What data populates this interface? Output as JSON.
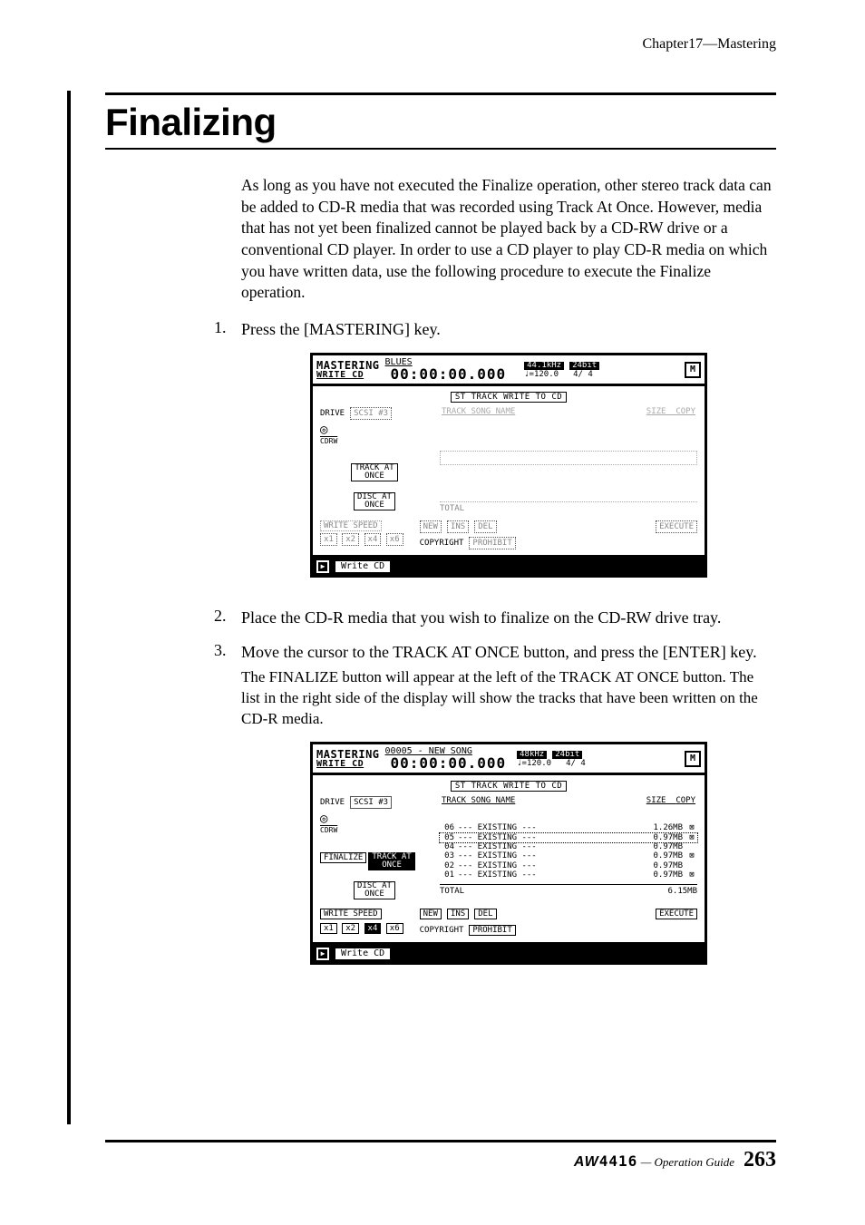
{
  "header": {
    "running": "Chapter17—Mastering"
  },
  "title": "Finalizing",
  "para1": "As long as you have not executed the Finalize operation, other stereo track data can be added to CD-R media that was recorded using Track At Once. However, media that has not yet been finalized cannot be played back by a CD-RW drive or a conventional CD player. In order to use a CD player to play CD-R media on which you have written data, use the following procedure to execute the Finalize operation.",
  "step1": {
    "num": "1.",
    "text": "Press the [MASTERING] key."
  },
  "step2": {
    "num": "2.",
    "text": "Place the CD-R media that you wish to finalize on the CD-RW drive tray."
  },
  "step3": {
    "num": "3.",
    "text": "Move the cursor to the TRACK AT ONCE button, and press the [ENTER] key."
  },
  "step3_sub": "The FINALIZE button will appear at the left of the TRACK AT ONCE button. The list in the right side of the display will show the tracks that have been written on the CD-R media.",
  "lcd_common": {
    "mastering": "MASTERING",
    "write_cd": "WRITE CD",
    "time": "00:00:00.000",
    "tempo": "♩=120.0",
    "meter": "4/ 4",
    "m": "M",
    "section": "ST TRACK WRITE TO CD",
    "drive_label": "DRIVE",
    "drive_value": "SCSI #3",
    "cdrw": "CDRW",
    "track_at_once": "TRACK AT\nONCE",
    "disc_at_once": "DISC AT\nONCE",
    "total": "TOTAL",
    "write_speed": "WRITE SPEED",
    "speeds": [
      "x1",
      "x2",
      "x4",
      "x6"
    ],
    "new": "NEW",
    "ins": "INS",
    "del": "DEL",
    "execute": "EXECUTE",
    "copyright": "COPYRIGHT",
    "prohibit": "PROHIBIT",
    "tab": "Write CD",
    "track_song_hdr": "TRACK SONG NAME",
    "size_hdr": "SIZE",
    "copy_hdr": "COPY"
  },
  "lcd1": {
    "song": "BLUES",
    "khz": "44.1kHz",
    "bit": "24bit"
  },
  "lcd2": {
    "song": "00005 - NEW SONG",
    "khz": "48kHz",
    "bit": "24bit",
    "finalize": "FINALIZE",
    "tracks": [
      {
        "no": "06",
        "name": "--- EXISTING ---",
        "size": "1.26MB",
        "copy": "⊠"
      },
      {
        "no": "05",
        "name": "--- EXISTING ---",
        "size": "0.97MB",
        "copy": "⊠"
      },
      {
        "no": "04",
        "name": "--- EXISTING ---",
        "size": "0.97MB",
        "copy": ""
      },
      {
        "no": "03",
        "name": "--- EXISTING ---",
        "size": "0.97MB",
        "copy": "⊠"
      },
      {
        "no": "02",
        "name": "--- EXISTING ---",
        "size": "0.97MB",
        "copy": ""
      },
      {
        "no": "01",
        "name": "--- EXISTING ---",
        "size": "0.97MB",
        "copy": "⊠"
      }
    ],
    "total_size": "6.15MB"
  },
  "footer": {
    "brand_a": "AW",
    "brand_b": "4416",
    "guide": "— Operation Guide",
    "page": "263"
  }
}
